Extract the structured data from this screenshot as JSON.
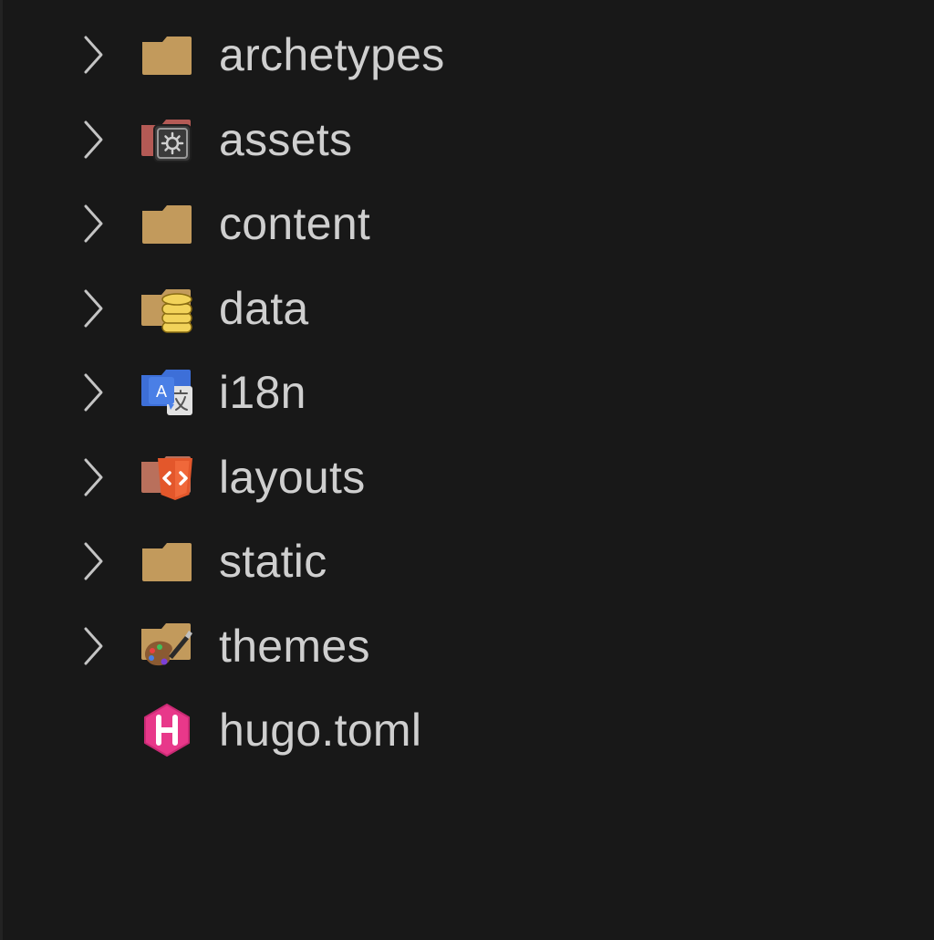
{
  "explorer": {
    "items": [
      {
        "label": "archetypes",
        "kind": "folder",
        "icon": "folder-icon",
        "expandable": true
      },
      {
        "label": "assets",
        "kind": "folder",
        "icon": "folder-assets-icon",
        "expandable": true
      },
      {
        "label": "content",
        "kind": "folder",
        "icon": "folder-icon",
        "expandable": true
      },
      {
        "label": "data",
        "kind": "folder",
        "icon": "folder-data-icon",
        "expandable": true
      },
      {
        "label": "i18n",
        "kind": "folder",
        "icon": "folder-i18n-icon",
        "expandable": true
      },
      {
        "label": "layouts",
        "kind": "folder",
        "icon": "folder-layouts-icon",
        "expandable": true
      },
      {
        "label": "static",
        "kind": "folder",
        "icon": "folder-icon",
        "expandable": true
      },
      {
        "label": "themes",
        "kind": "folder",
        "icon": "folder-themes-icon",
        "expandable": true
      },
      {
        "label": "hugo.toml",
        "kind": "file",
        "icon": "hugo-file-icon",
        "expandable": false
      }
    ]
  },
  "colors": {
    "background": "#181818",
    "text": "#cfcfcf",
    "chevron": "#c4c4c4",
    "folder": "#c29a5c",
    "assets_folder": "#b45a55",
    "data_stack": "#f2d35a",
    "i18n_blue": "#3d6fd8",
    "layouts_orange": "#e3572b",
    "hugo_pink": "#e8388a"
  }
}
